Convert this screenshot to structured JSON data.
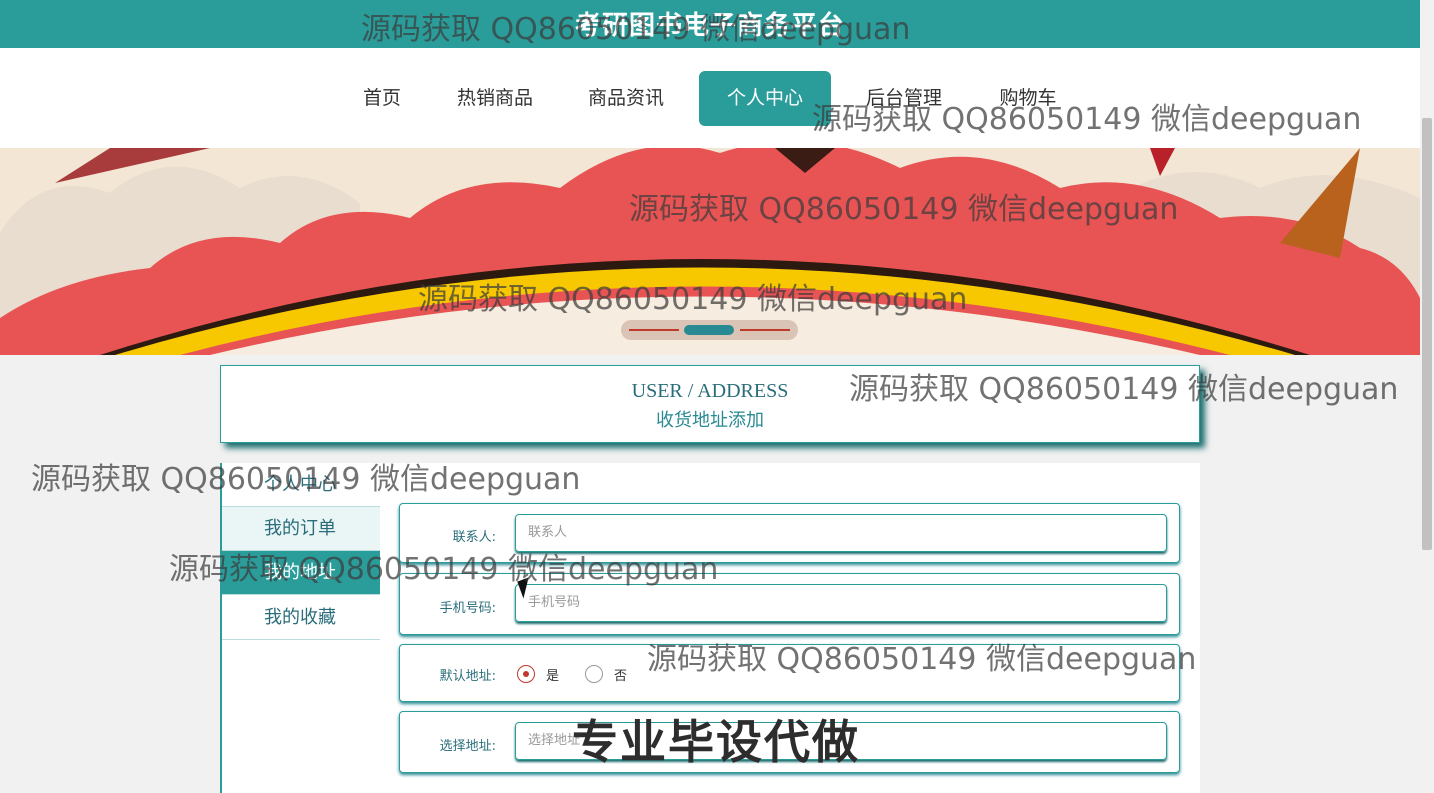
{
  "site": {
    "title": "考研图书电子商务平台"
  },
  "nav": {
    "items": [
      "首页",
      "热销商品",
      "商品资讯",
      "个人中心",
      "后台管理",
      "购物车"
    ],
    "active_index": 3
  },
  "page_header": {
    "en": "USER / ADDRESS",
    "zh": "收货地址添加"
  },
  "sidebar": {
    "items": [
      "个人中心",
      "我的订单",
      "我的地址",
      "我的收藏"
    ],
    "active": "我的地址"
  },
  "form": {
    "contact": {
      "label": "联系人:",
      "placeholder": "联系人"
    },
    "phone": {
      "label": "手机号码:",
      "placeholder": "手机号码"
    },
    "default_address": {
      "label": "默认地址:",
      "options": [
        "是",
        "否"
      ],
      "selected": "是"
    },
    "address": {
      "label": "选择地址:",
      "placeholder": "选择地址"
    }
  },
  "watermark": {
    "text": "源码获取 QQ86050149 微信deepguan",
    "banner_text": "专业毕设代做"
  },
  "colors": {
    "primary": "#2a9d9b",
    "banner_red": "#e85454",
    "banner_yellow": "#f7c800"
  },
  "carousel": {
    "active_dot": 1
  }
}
